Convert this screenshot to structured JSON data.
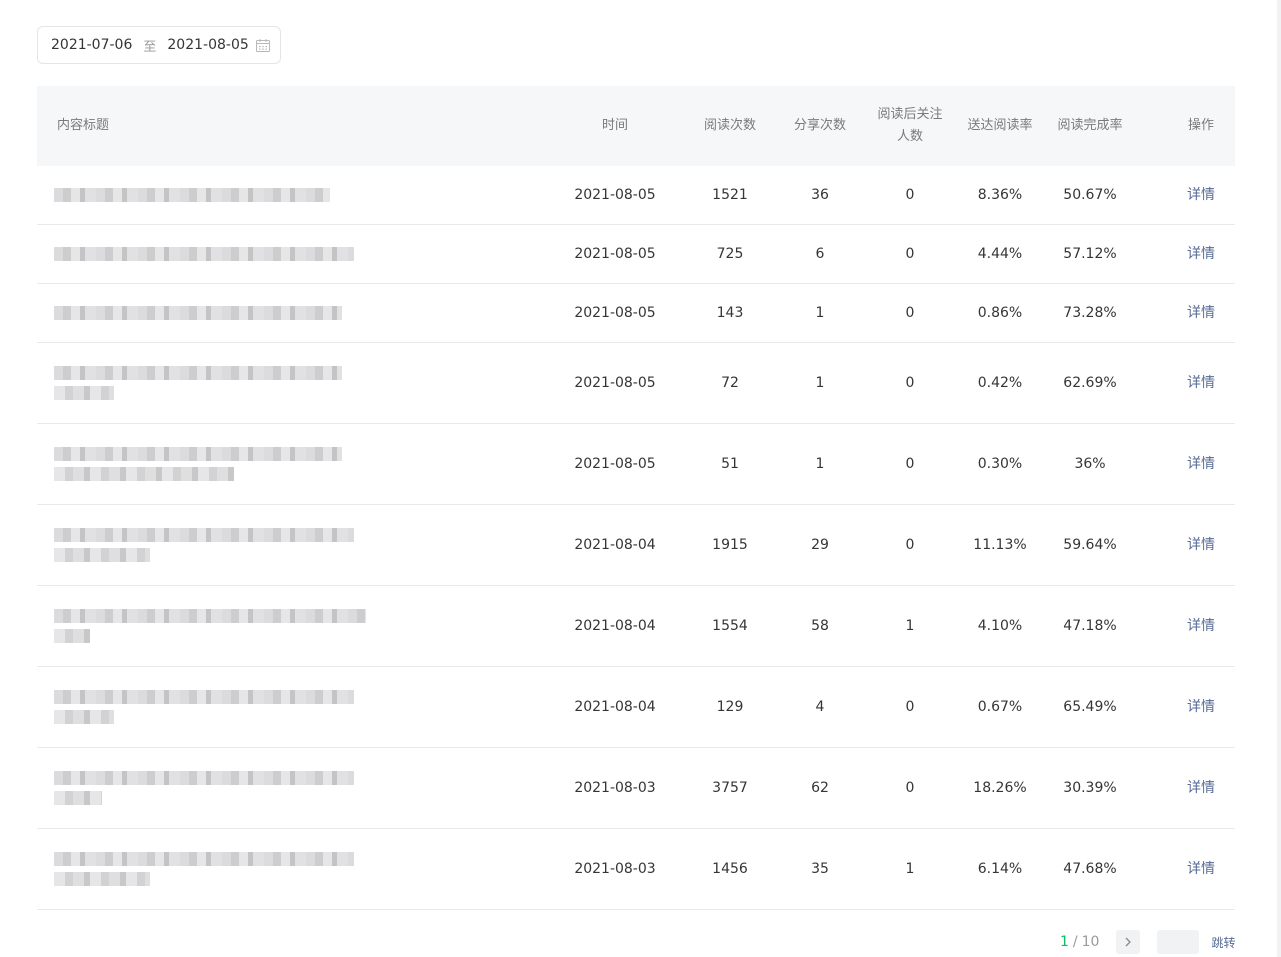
{
  "date_range": {
    "start": "2021-07-06",
    "separator": "至",
    "end": "2021-08-05"
  },
  "table": {
    "headers": {
      "title": "内容标题",
      "time": "时间",
      "reads": "阅读次数",
      "shares": "分享次数",
      "follow": "阅读后关注人数",
      "rate": "送达阅读率",
      "complete": "阅读完成率",
      "op": "操作"
    },
    "rows": [
      {
        "time": "2021-08-05",
        "reads": "1521",
        "shares": "36",
        "follow": "0",
        "rate": "8.36%",
        "complete": "50.67%",
        "op": "详情",
        "title_lines": 1
      },
      {
        "time": "2021-08-05",
        "reads": "725",
        "shares": "6",
        "follow": "0",
        "rate": "4.44%",
        "complete": "57.12%",
        "op": "详情",
        "title_lines": 1
      },
      {
        "time": "2021-08-05",
        "reads": "143",
        "shares": "1",
        "follow": "0",
        "rate": "0.86%",
        "complete": "73.28%",
        "op": "详情",
        "title_lines": 1
      },
      {
        "time": "2021-08-05",
        "reads": "72",
        "shares": "1",
        "follow": "0",
        "rate": "0.42%",
        "complete": "62.69%",
        "op": "详情",
        "title_lines": 2
      },
      {
        "time": "2021-08-05",
        "reads": "51",
        "shares": "1",
        "follow": "0",
        "rate": "0.30%",
        "complete": "36%",
        "op": "详情",
        "title_lines": 2
      },
      {
        "time": "2021-08-04",
        "reads": "1915",
        "shares": "29",
        "follow": "0",
        "rate": "11.13%",
        "complete": "59.64%",
        "op": "详情",
        "title_lines": 2
      },
      {
        "time": "2021-08-04",
        "reads": "1554",
        "shares": "58",
        "follow": "1",
        "rate": "4.10%",
        "complete": "47.18%",
        "op": "详情",
        "title_lines": 2
      },
      {
        "time": "2021-08-04",
        "reads": "129",
        "shares": "4",
        "follow": "0",
        "rate": "0.67%",
        "complete": "65.49%",
        "op": "详情",
        "title_lines": 2
      },
      {
        "time": "2021-08-03",
        "reads": "3757",
        "shares": "62",
        "follow": "0",
        "rate": "18.26%",
        "complete": "30.39%",
        "op": "详情",
        "title_lines": 2
      },
      {
        "time": "2021-08-03",
        "reads": "1456",
        "shares": "35",
        "follow": "1",
        "rate": "6.14%",
        "complete": "47.68%",
        "op": "详情",
        "title_lines": 2
      }
    ]
  },
  "pagination": {
    "current": "1",
    "separator": "/",
    "total": "10",
    "jump_label": "跳转",
    "next_icon": "chevron-right-icon"
  },
  "icons": {
    "calendar": "calendar-icon"
  },
  "colors": {
    "link": "#576b95",
    "accent": "#07c160",
    "header_bg": "#f6f7f9",
    "border": "#e8e9ec"
  }
}
